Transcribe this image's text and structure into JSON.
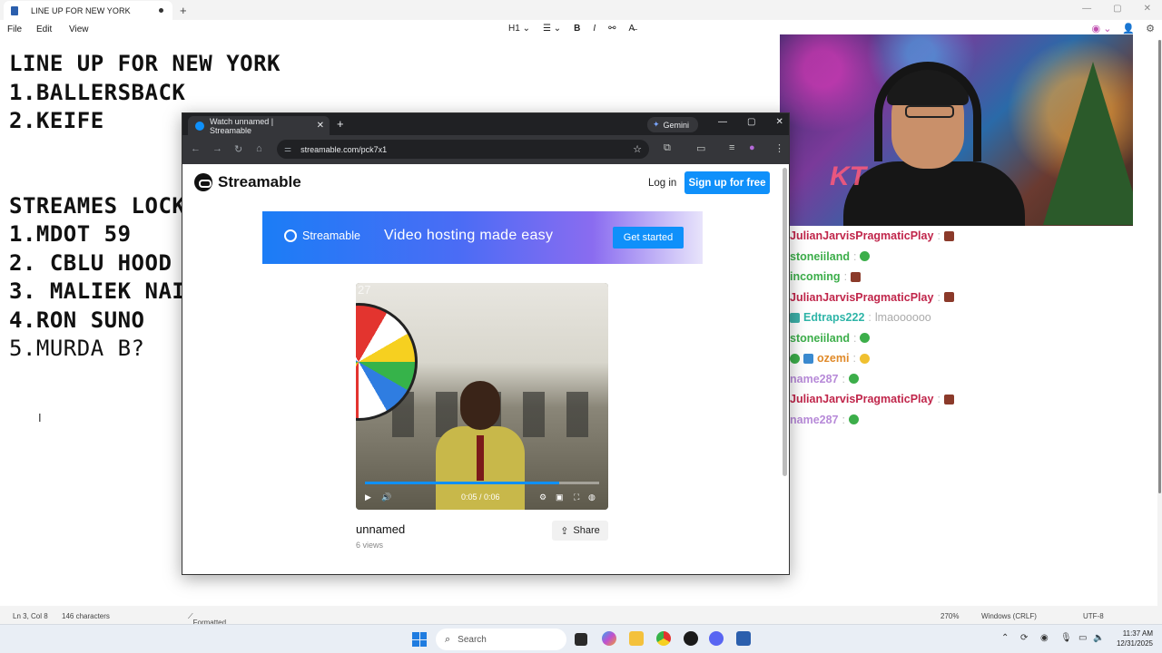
{
  "notepad": {
    "tab_title": "LINE UP FOR NEW YORK",
    "menu": [
      "File",
      "Edit",
      "View"
    ],
    "toolbar": {
      "heading": "H1",
      "list": "☰",
      "bold": "B",
      "italic": "I",
      "link": "🔗",
      "spell": "A"
    },
    "lines": [
      "LINE UP FOR NEW YORK",
      "1.BALLERSBACK",
      "2.KEIFE",
      "",
      "STREAMES LOCK",
      "1.MDOT 59",
      "2. CBLU HOOD",
      "3. MALIEK NAI",
      "4.RON SUNO",
      "5.MURDA B?"
    ],
    "status": {
      "position": "Ln 3, Col 8",
      "chars": "146 characters",
      "format": "Formatted",
      "zoom": "270%",
      "line_ending": "Windows (CRLF)",
      "encoding": "UTF-8"
    }
  },
  "chat": [
    {
      "user": "JulianJarvisPragmaticPlay",
      "color": "#c0254a",
      "emote": "brick",
      "msg": ""
    },
    {
      "user": "stoneiiland",
      "color": "#3cae4a",
      "emote": "check",
      "msg": ""
    },
    {
      "user": "incoming",
      "color": "#3cae4a",
      "emote": "brick",
      "msg": ""
    },
    {
      "user": "JulianJarvisPragmaticPlay",
      "color": "#c0254a",
      "emote": "brick",
      "msg": ""
    },
    {
      "user": "Edtraps222",
      "color": "#2fb5a8",
      "emote": "",
      "msg": "lmaoooooo",
      "badge": true
    },
    {
      "user": "stoneiiland",
      "color": "#3cae4a",
      "emote": "check",
      "msg": ""
    },
    {
      "user": "ozemi",
      "color": "#e08a2a",
      "emote": "laugh",
      "msg": "",
      "prebadges": true
    },
    {
      "user": "name287",
      "color": "#b78ad8",
      "emote": "check",
      "msg": ""
    },
    {
      "user": "JulianJarvisPragmaticPlay",
      "color": "#c0254a",
      "emote": "brick",
      "msg": ""
    },
    {
      "user": "name287",
      "color": "#b78ad8",
      "emote": "check",
      "msg": ""
    }
  ],
  "browser": {
    "tab_title": "Watch unnamed | Streamable",
    "gemini_label": "Gemini",
    "url": "streamable.com/pck7x1",
    "site": {
      "logo_text": "Streamable",
      "login": "Log in",
      "signup": "Sign up for free",
      "banner": {
        "logo": "Streamable",
        "tagline": "Video hosting made easy",
        "cta": "Get started"
      },
      "video": {
        "counter": "27",
        "time": "0:05 / 0:06",
        "progress": 0.83
      },
      "title": "unnamed",
      "views": "6 views",
      "share": "Share"
    }
  },
  "taskbar": {
    "search_placeholder": "Search",
    "time": "11:37 AM",
    "date": "12/31/2025"
  }
}
